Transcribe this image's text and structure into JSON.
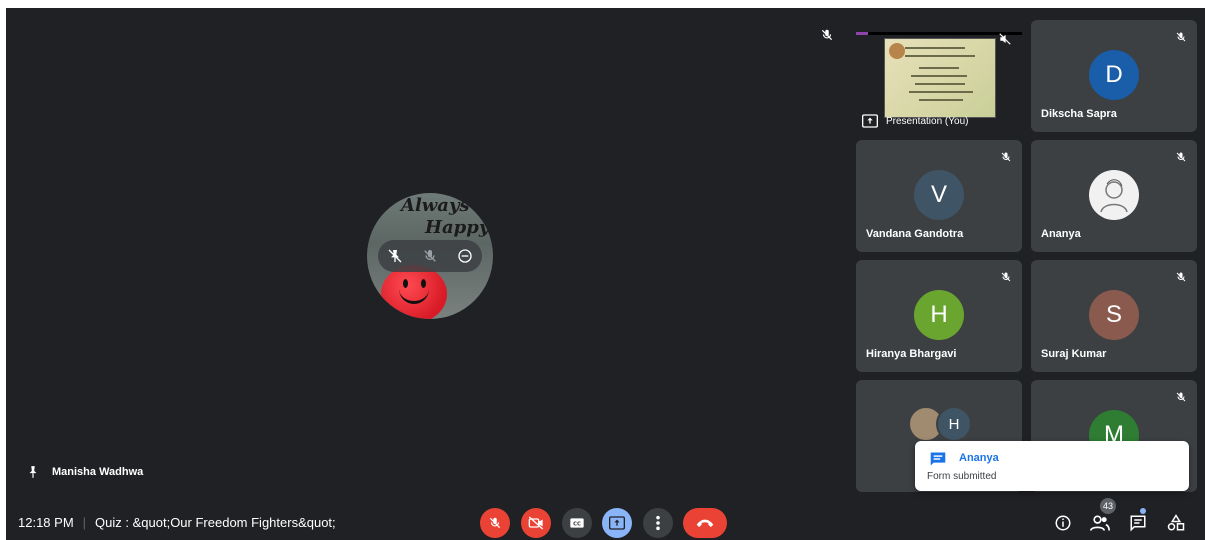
{
  "main": {
    "speaker_name": "Manisha Wadhwa",
    "avatar_text_top": "Always",
    "avatar_text_mid": "Happy"
  },
  "tiles": [
    {
      "kind": "presentation",
      "label": "Presentation (You)",
      "slide_title": "Department of Computer Science"
    },
    {
      "kind": "person",
      "name": "Dikscha Sapra",
      "initial": "D",
      "color": "#1a5da8"
    },
    {
      "kind": "person",
      "name": "Vandana Gandotra",
      "initial": "V",
      "color": "#3f5464"
    },
    {
      "kind": "person",
      "name": "Ananya",
      "initial": "",
      "color": "#f1f1f1"
    },
    {
      "kind": "person",
      "name": "Hiranya Bhargavi",
      "initial": "H",
      "color": "#6aa62f"
    },
    {
      "kind": "person",
      "name": "Suraj Kumar",
      "initial": "S",
      "color": "#8a5a4e"
    },
    {
      "kind": "group",
      "name": "",
      "initial": "H",
      "color": "#3f5464"
    },
    {
      "kind": "person",
      "name": "",
      "initial": "M",
      "color": "#2e7d32"
    }
  ],
  "toast": {
    "name": "Ananya",
    "message": "Form submitted"
  },
  "bottom": {
    "time": "12:18 PM",
    "meeting_title": "Quiz : &quot;Our Freedom Fighters&quot;",
    "participant_count": "43"
  },
  "colors": {
    "background": "#202124",
    "tile": "#3c4043",
    "danger": "#ea4335",
    "accent": "#8ab4f8"
  },
  "icons": {
    "mic_off": "mic-off-icon",
    "cam_off": "videocam-off-icon",
    "captions": "closed-caption-icon",
    "present": "present-screen-icon",
    "more": "more-vert-icon",
    "end_call": "call-end-icon",
    "info": "info-icon",
    "people": "people-icon",
    "chat": "chat-icon",
    "activities": "activities-icon"
  }
}
